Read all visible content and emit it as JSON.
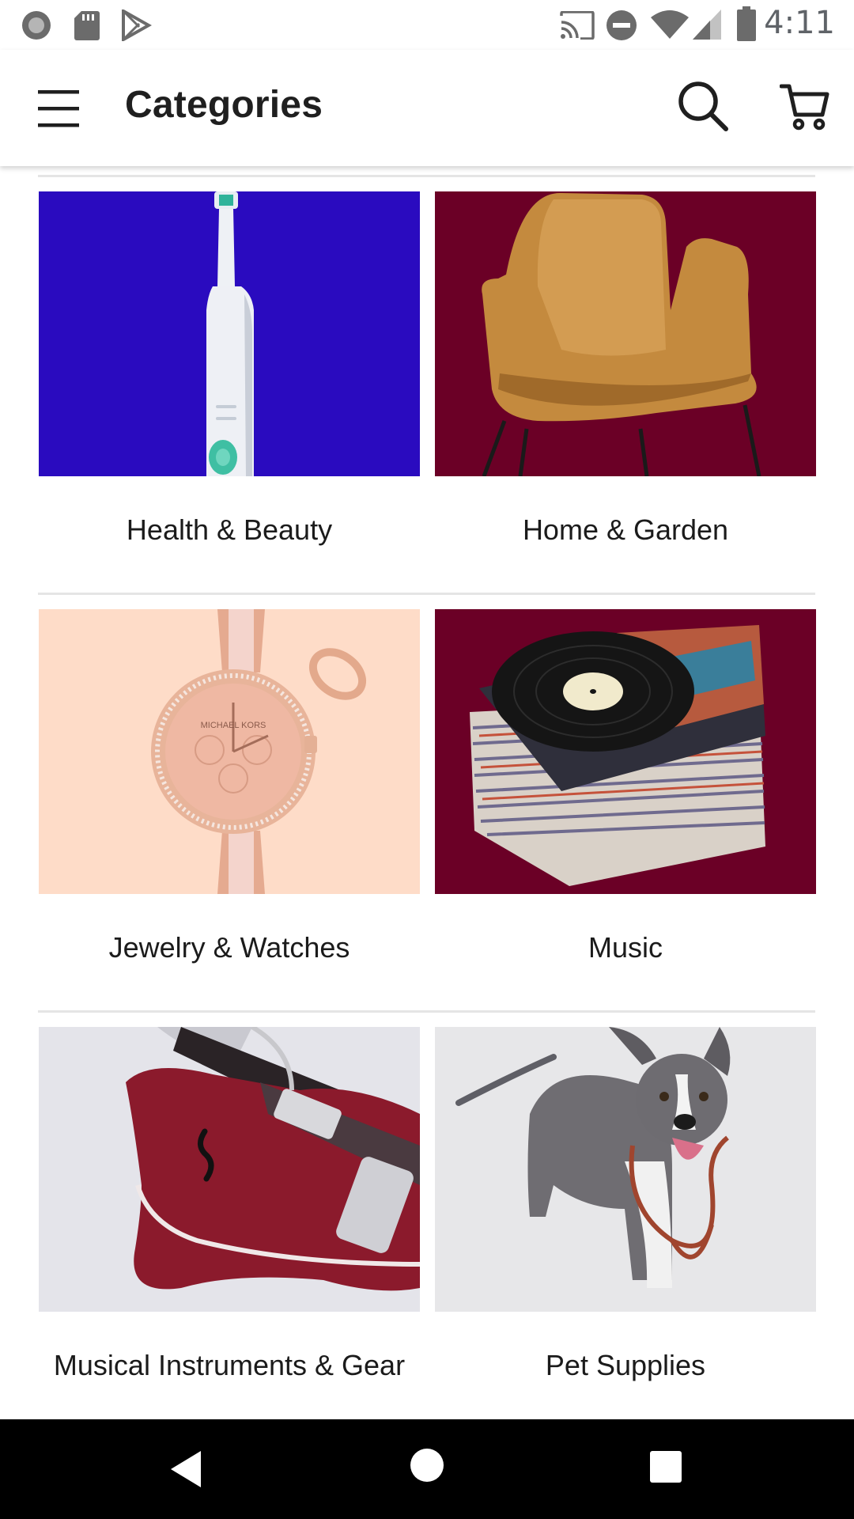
{
  "status_bar": {
    "time": "4:11",
    "left_icons": [
      "record-icon",
      "sd-card-icon",
      "play-store-icon"
    ],
    "right_icons": [
      "cast-icon",
      "do-not-disturb-icon",
      "wifi-icon",
      "cellular-signal-icon",
      "battery-icon"
    ]
  },
  "app_bar": {
    "title": "Categories",
    "menu_icon": "hamburger-menu-icon",
    "search_icon": "search-icon",
    "cart_icon": "cart-icon"
  },
  "categories": [
    {
      "label": "Health & Beauty",
      "image": "toothbrush",
      "bg": "#2a0bbf"
    },
    {
      "label": "Home & Garden",
      "image": "leather-chair",
      "bg": "#6b0026"
    },
    {
      "label": "Jewelry & Watches",
      "image": "rose-gold-watch",
      "bg": "#fedcc8"
    },
    {
      "label": "Music",
      "image": "vinyl-records",
      "bg": "#6b0026"
    },
    {
      "label": "Musical Instruments & Gear",
      "image": "red-guitar",
      "bg": "#e4e4ea"
    },
    {
      "label": "Pet Supplies",
      "image": "dog-with-leash",
      "bg": "#e7e7e9"
    }
  ],
  "image_text": {
    "watch_brand": "MICHAEL KORS"
  },
  "nav_bar": {
    "back_icon": "back-icon",
    "home_icon": "home-icon",
    "recents_icon": "recents-icon"
  }
}
